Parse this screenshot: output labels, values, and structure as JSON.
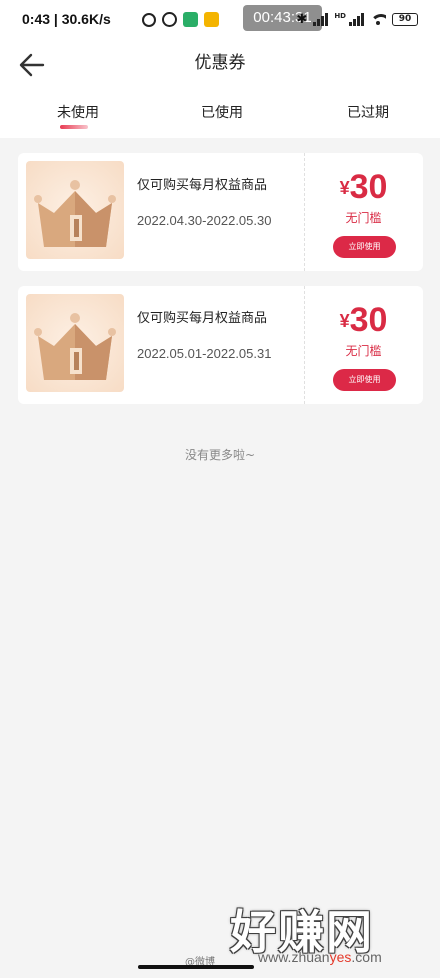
{
  "status_bar": {
    "time_speed": "0:43 | 30.6K/s",
    "clock_chip": "00:43:31",
    "network_tag": "HD",
    "battery": "90",
    "icons": [
      "mute-icon",
      "alarm-icon",
      "wechat-icon",
      "app-icon",
      "bluetooth-icon",
      "signal-icon",
      "wifi-icon",
      "battery-icon"
    ]
  },
  "header": {
    "title": "优惠券",
    "back_icon": "arrow-left-icon"
  },
  "tabs": [
    {
      "label": "未使用",
      "active": true
    },
    {
      "label": "已使用",
      "active": false
    },
    {
      "label": "已过期",
      "active": false
    }
  ],
  "coupons": [
    {
      "description": "仅可购买每月权益商品",
      "date_range": "2022.04.30-2022.05.30",
      "currency": "¥",
      "amount": "30",
      "threshold": "无门槛",
      "button": "立即使用"
    },
    {
      "description": "仅可购买每月权益商品",
      "date_range": "2022.05.01-2022.05.31",
      "currency": "¥",
      "amount": "30",
      "threshold": "无门槛",
      "button": "立即使用"
    }
  ],
  "list_end_text": "没有更多啦~",
  "watermark": {
    "logo": "好赚网",
    "site_prefix": "www.zhuan",
    "site_highlight": "yes",
    "site_suffix": ".com",
    "weibo": "@微博"
  },
  "colors": {
    "accent": "#dc2947",
    "background": "#f4f4f4"
  }
}
